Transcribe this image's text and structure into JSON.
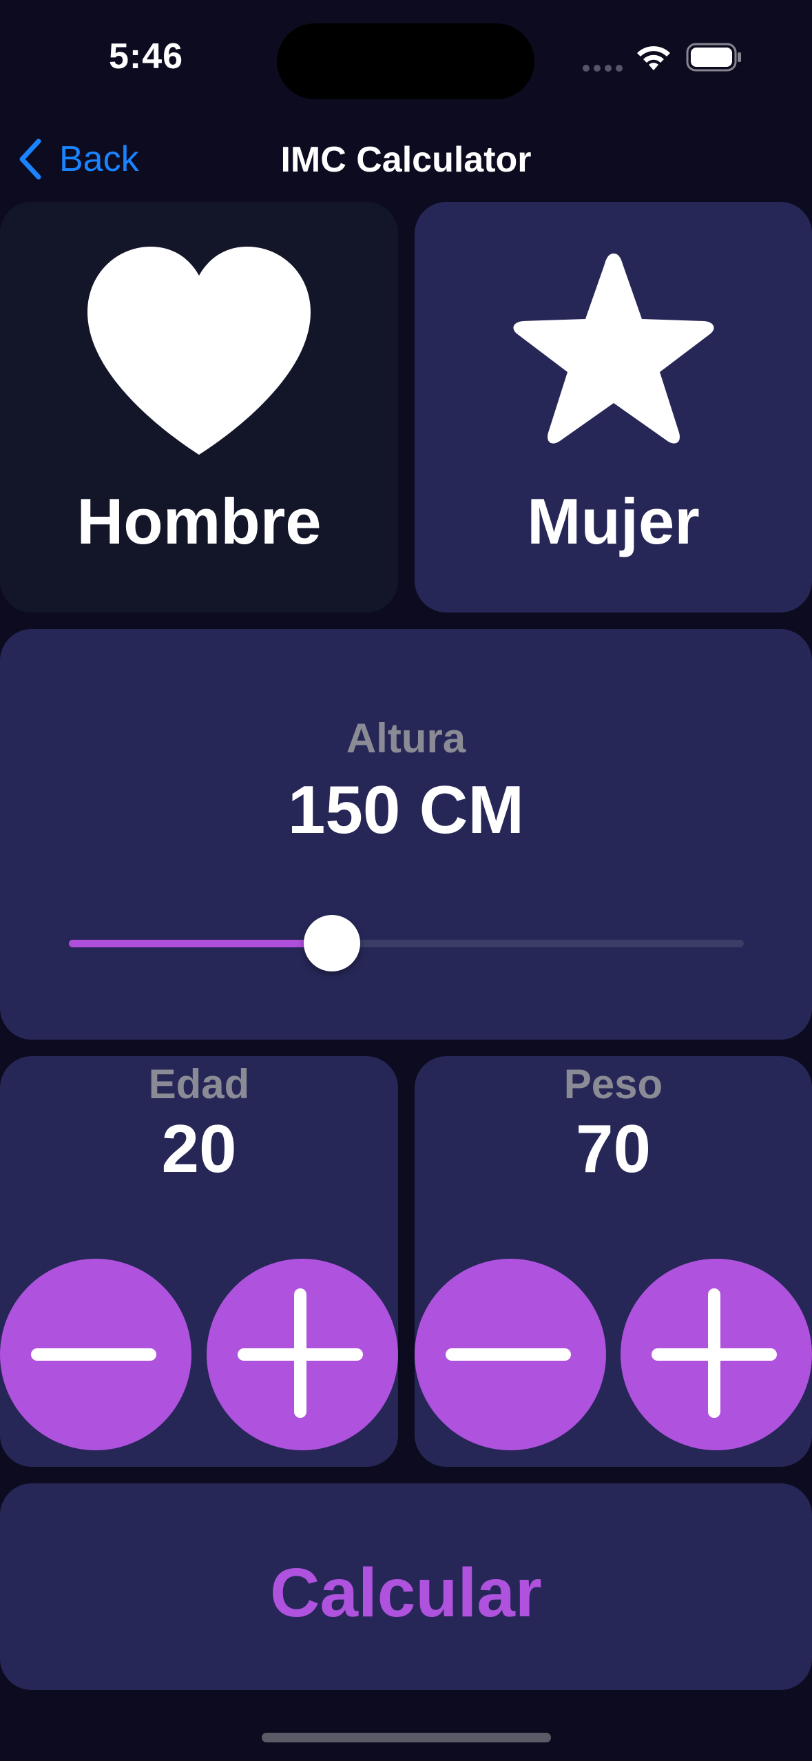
{
  "status_bar": {
    "time": "5:46",
    "icons": [
      "cellular-signal-icon",
      "wifi-icon",
      "battery-icon"
    ]
  },
  "nav": {
    "back_label": "Back",
    "title": "IMC Calculator",
    "back_icon": "chevron-left-icon"
  },
  "gender": {
    "male": {
      "label": "Hombre",
      "icon": "heart-icon",
      "selected": true
    },
    "female": {
      "label": "Mujer",
      "icon": "star-icon",
      "selected": false
    }
  },
  "height": {
    "label": "Altura",
    "value_text": "150 CM",
    "slider_fraction": 0.39
  },
  "age": {
    "label": "Edad",
    "value": "20"
  },
  "weight": {
    "label": "Peso",
    "value": "70"
  },
  "calculate": {
    "label": "Calcular"
  },
  "colors": {
    "background": "#0d0b20",
    "card": "#262757",
    "card_selected": "#131628",
    "accent": "#af52de",
    "link": "#1a84ff",
    "muted_text": "#8b8b96"
  }
}
